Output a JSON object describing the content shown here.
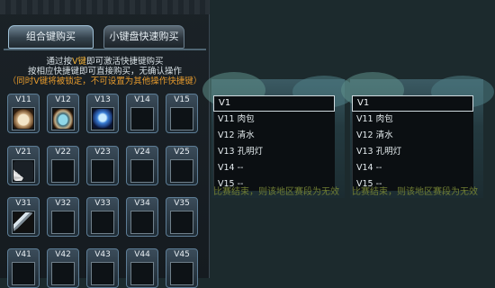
{
  "tabs": [
    {
      "label": "组合键购买",
      "active": true
    },
    {
      "label": "小键盘快速购买",
      "active": false
    }
  ],
  "instructions": {
    "line1_pre": "通过按",
    "line1_key": "V键",
    "line1_post": "即可激活快捷键购买",
    "line2": "按相应快捷键即可直接购买，无确认操作",
    "line3": "（同时V键将被锁定，不可设置为其他操作快捷键）"
  },
  "slots": [
    {
      "label": "V11",
      "item": "meat-bun-icon",
      "cls": "bun"
    },
    {
      "label": "V12",
      "item": "water-bowl-icon",
      "cls": "bowl"
    },
    {
      "label": "V13",
      "item": "kongming-lantern-icon",
      "cls": "lamp"
    },
    {
      "label": "V14",
      "item": "",
      "cls": ""
    },
    {
      "label": "V15",
      "item": "",
      "cls": ""
    },
    {
      "label": "V21",
      "item": "fan-icon",
      "cls": "fan"
    },
    {
      "label": "V22",
      "item": "",
      "cls": ""
    },
    {
      "label": "V23",
      "item": "",
      "cls": ""
    },
    {
      "label": "V24",
      "item": "",
      "cls": ""
    },
    {
      "label": "V25",
      "item": "",
      "cls": ""
    },
    {
      "label": "V31",
      "item": "sword-icon",
      "cls": "sword"
    },
    {
      "label": "V32",
      "item": "",
      "cls": ""
    },
    {
      "label": "V33",
      "item": "",
      "cls": ""
    },
    {
      "label": "V34",
      "item": "",
      "cls": ""
    },
    {
      "label": "V35",
      "item": "",
      "cls": ""
    },
    {
      "label": "V41",
      "item": "",
      "cls": ""
    },
    {
      "label": "V42",
      "item": "",
      "cls": ""
    },
    {
      "label": "V43",
      "item": "",
      "cls": ""
    },
    {
      "label": "V44",
      "item": "",
      "cls": ""
    },
    {
      "label": "V45",
      "item": "",
      "cls": ""
    }
  ],
  "dropdowns": [
    {
      "selected": "V1",
      "options": [
        "V11 肉包",
        "V12 清水",
        "V13 孔明灯",
        "V14 --",
        "V15 --"
      ],
      "marquee": "比赛结束，则该地区赛段为无效"
    },
    {
      "selected": "V1",
      "options": [
        "V11 肉包",
        "V12 清水",
        "V13 孔明灯",
        "V14 --",
        "V15 --"
      ],
      "marquee": "比赛结束，则该地区赛段为无效"
    }
  ]
}
